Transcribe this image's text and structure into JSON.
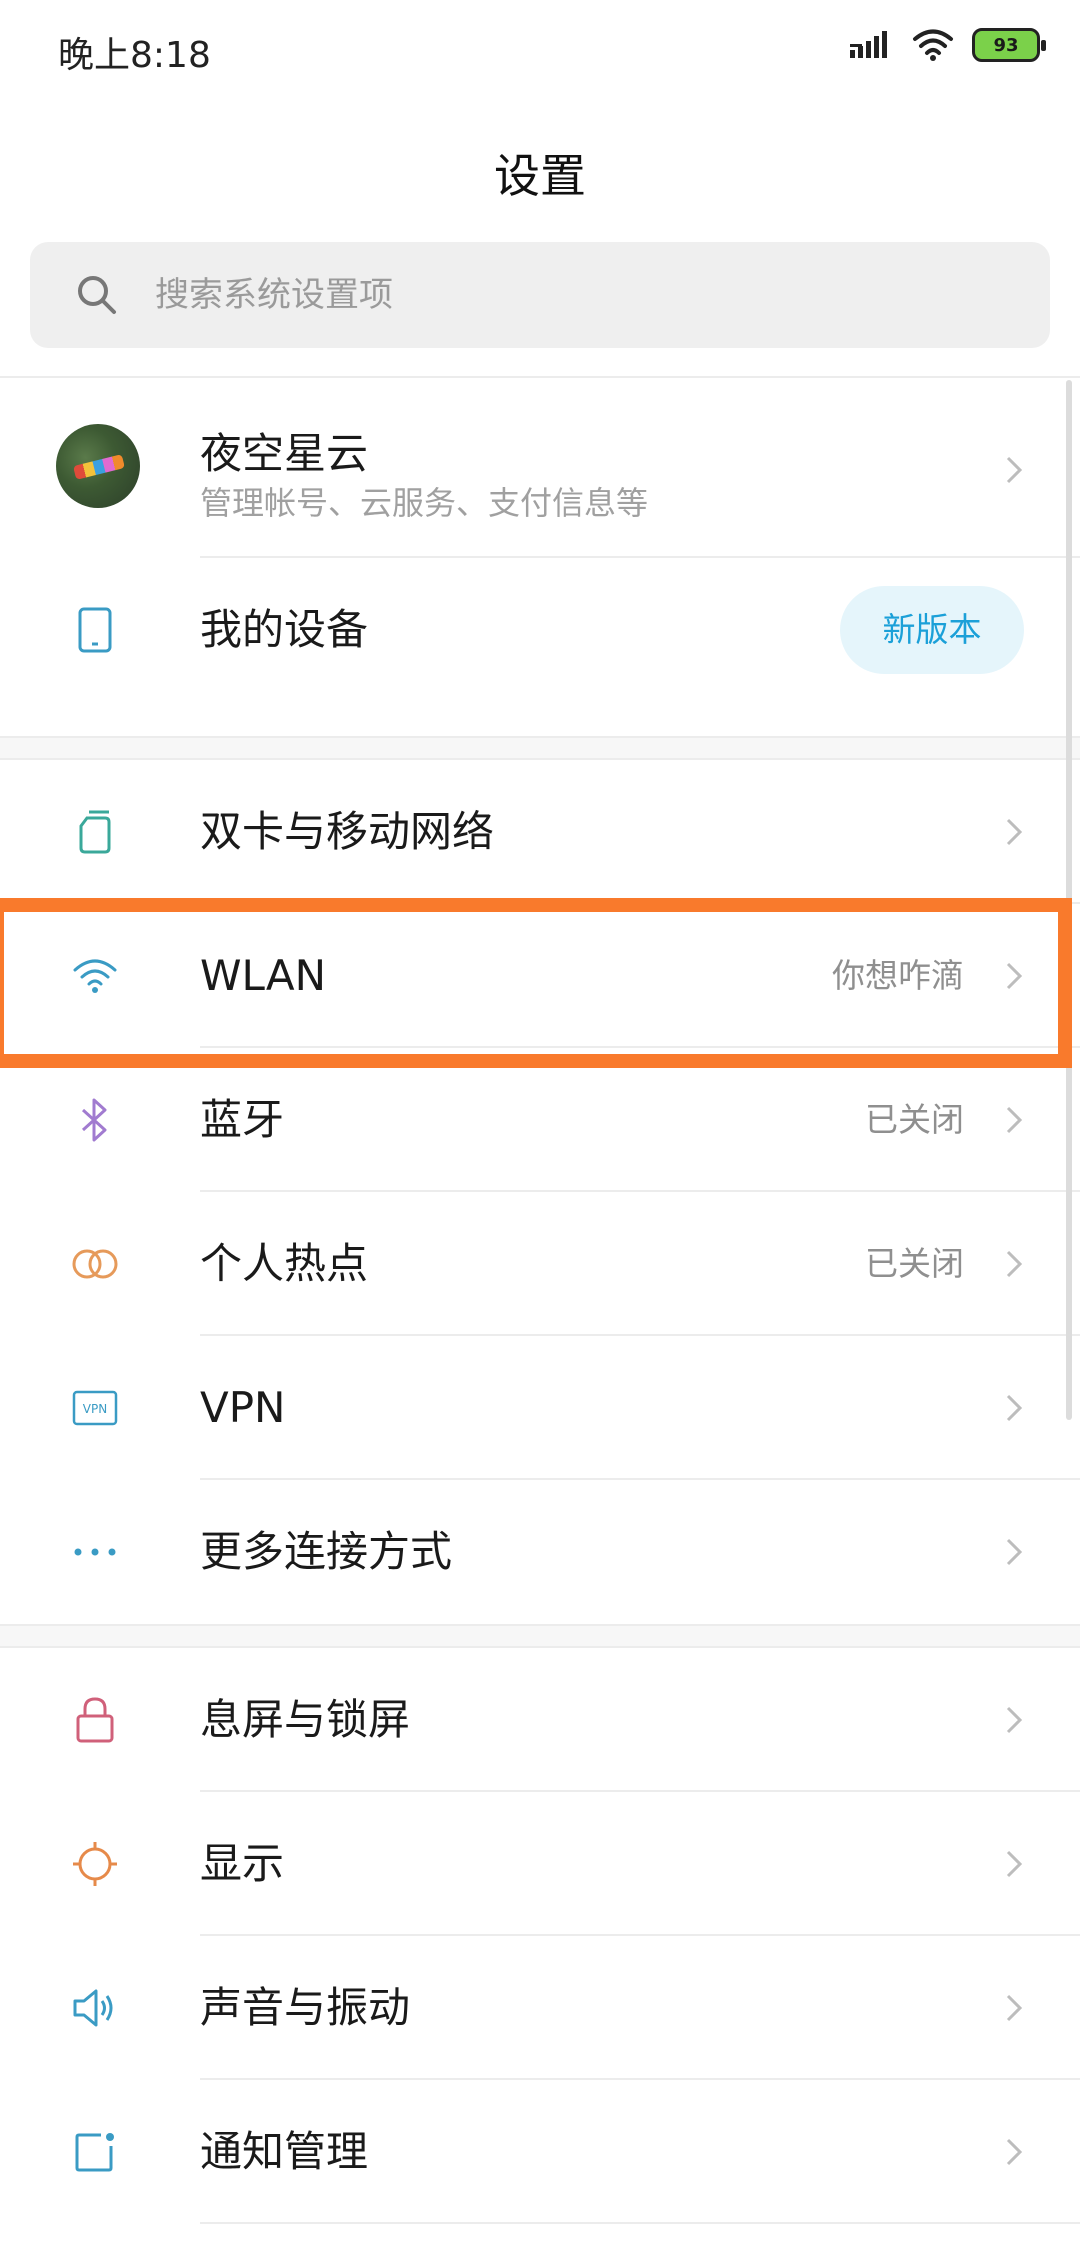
{
  "status_bar": {
    "time": "晚上8:18",
    "battery": "93",
    "icons": [
      "signal-icon",
      "wifi-icon",
      "battery-icon"
    ]
  },
  "header": {
    "title": "设置"
  },
  "search": {
    "placeholder": "搜索系统设置项"
  },
  "account": {
    "name": "夜空星云",
    "subtitle": "管理帐号、云服务、支付信息等"
  },
  "my_device": {
    "label": "我的设备",
    "badge": "新版本"
  },
  "network_items": [
    {
      "label": "双卡与移动网络",
      "value": ""
    },
    {
      "label": "WLAN",
      "value": "你想咋滴"
    },
    {
      "label": "蓝牙",
      "value": "已关闭"
    },
    {
      "label": "个人热点",
      "value": "已关闭"
    },
    {
      "label": "VPN",
      "value": ""
    },
    {
      "label": "更多连接方式",
      "value": ""
    }
  ],
  "system_items": [
    {
      "label": "息屏与锁屏"
    },
    {
      "label": "显示"
    },
    {
      "label": "声音与振动"
    },
    {
      "label": "通知管理"
    }
  ],
  "colors": {
    "highlight": "#f97a2c",
    "accent": "#1ba0d8",
    "badge_bg": "#e5f5fb"
  }
}
